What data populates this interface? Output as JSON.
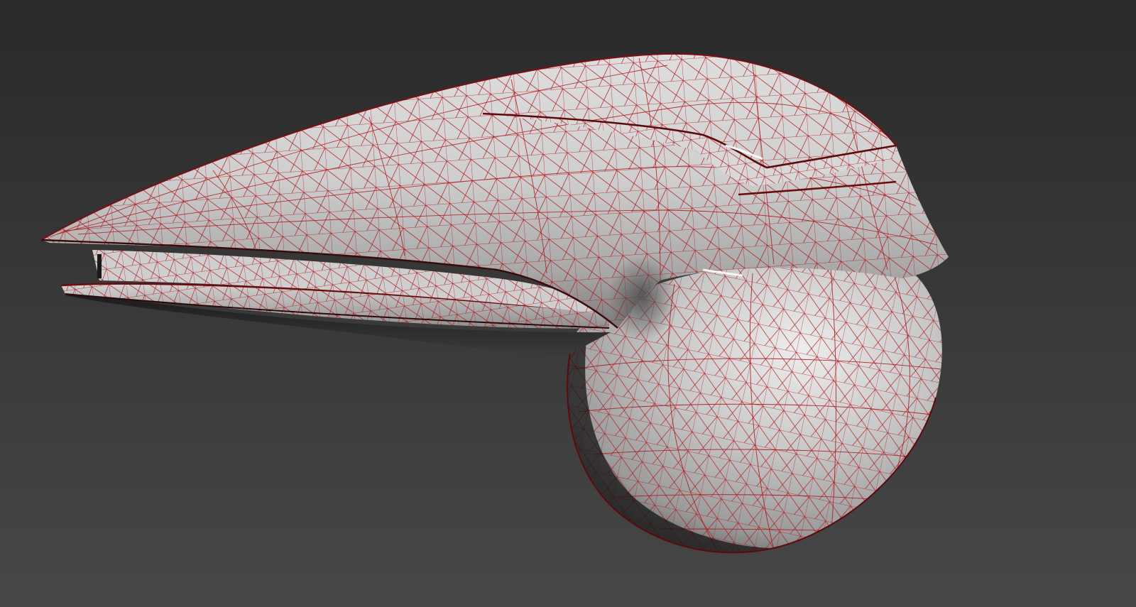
{
  "viewport": {
    "background_top": "#2a2a2a",
    "background_bottom": "#474747",
    "wire_color": "#b0151a",
    "shade_light": "#e9e9e9",
    "shade_mid": "#b9b9b9",
    "shade_dark": "#5a5a5a",
    "edge_dark": "#141414"
  },
  "model": {
    "icon": "wireframe-mesh-icon",
    "display_mode": "shaded-with-wireframe"
  }
}
